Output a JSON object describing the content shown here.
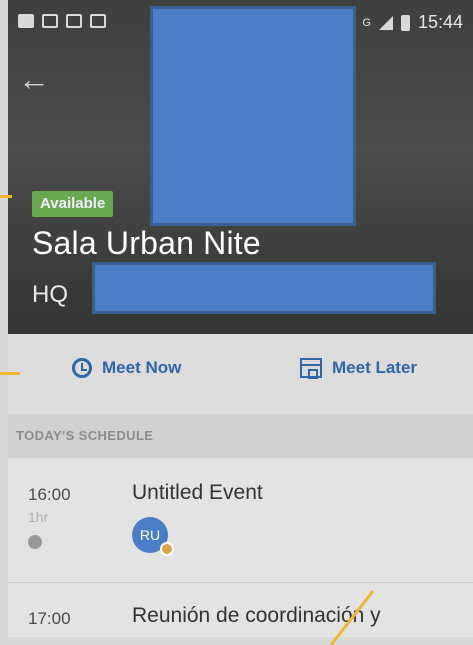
{
  "status_bar": {
    "time": "15:44",
    "left_icons": [
      "youtube-icon",
      "gallery-icon",
      "vpn-icon",
      "gmail-icon"
    ],
    "right_icons": [
      "signal-icon",
      "battery-icon"
    ],
    "network_label": "G"
  },
  "header": {
    "back_icon": "arrow-left-icon",
    "availability_badge": "Available",
    "room_name": "Sala Urban Nite",
    "location": "HQ"
  },
  "actions": {
    "meet_now": {
      "label": "Meet Now",
      "icon": "clock-icon"
    },
    "meet_later": {
      "label": "Meet Later",
      "icon": "calendar-icon"
    }
  },
  "schedule": {
    "section_title": "TODAY'S SCHEDULE",
    "events": [
      {
        "time": "16:00",
        "duration": "1hr",
        "title": "Untitled Event",
        "attendee_initials": "RU"
      },
      {
        "time": "17:00",
        "title": "Reunión de coordinación y"
      }
    ]
  },
  "colors": {
    "accent": "#2f66a8",
    "available_badge": "#6aa84f",
    "redaction": "#4a7ec6",
    "annotation_arrow": "#f2b62d"
  }
}
